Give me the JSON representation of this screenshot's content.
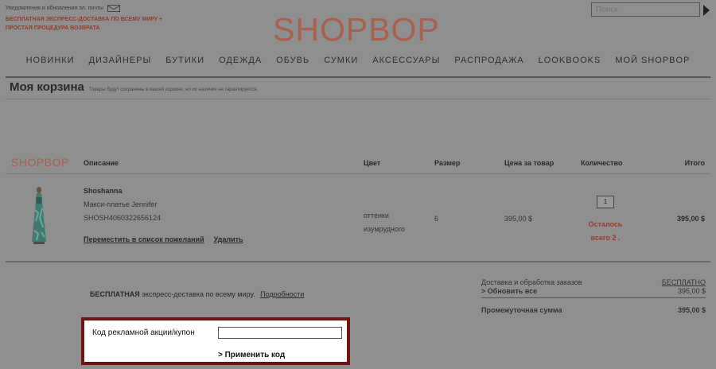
{
  "header": {
    "notifications_text": "Уведомления и обновления эл. почты",
    "promo_lines": [
      "БЕСПЛАТНАЯ ЭКСПРЕСС-ДОСТАВКА ПО ВСЕМУ МИРУ +",
      "ПРОСТАЯ ПРОЦЕДУРА ВОЗВРАТА"
    ],
    "logo": "SHOPBOP",
    "search_placeholder": "Поиск"
  },
  "nav": {
    "items": [
      "НОВИНКИ",
      "ДИЗАЙНЕРЫ",
      "БУТИКИ",
      "ОДЕЖДА",
      "ОБУВЬ",
      "СУМКИ",
      "АКСЕССУАРЫ",
      "РАСПРОДАЖА",
      "LOOKBOOKS",
      "МОЙ SHOPBOP"
    ]
  },
  "cart": {
    "title": "Моя корзина",
    "note": "Товары будут сохранены в вашей корзине, но их наличие не гарантируется."
  },
  "table": {
    "logo": "SHOPBOP",
    "headers": {
      "description": "Описание",
      "color": "Цвет",
      "size": "Размер",
      "price": "Цена за товар",
      "quantity": "Количество",
      "total": "Итого"
    }
  },
  "item": {
    "brand": "Shoshanna",
    "name": "Макси-платье Jennifer",
    "sku": "SHOSH4060322656124",
    "wishlist_link": "Переместить в список пожеланий",
    "delete_link": "Удалить",
    "color_line1": "оттенки",
    "color_line2": "изумрудного",
    "size": "6",
    "price": "395,00 $",
    "quantity": "1",
    "stock_line1": "Осталось",
    "stock_line2": "всего 2 .",
    "total": "395,00 $"
  },
  "shipping": {
    "text_bold": "БЕСПЛАТНАЯ",
    "text_rest": "экспресс-доставка по всему миру.",
    "details_link": "Подробности"
  },
  "summary": {
    "delivery_label": "Доставка и обработка заказов",
    "delivery_value": "БЕСПЛАТНО",
    "update_label": "> Обновить все",
    "update_value": "395,00 $",
    "subtotal_label": "Промежуточная сумма",
    "subtotal_value": "395,00 $"
  },
  "coupon": {
    "label": "Код рекламной акции/купон",
    "input_value": "",
    "apply_label": "> Применить код"
  },
  "colors": {
    "brand": "#a8614e",
    "stock_warning": "#9e3a32",
    "highlight_border": "#6b1613"
  }
}
